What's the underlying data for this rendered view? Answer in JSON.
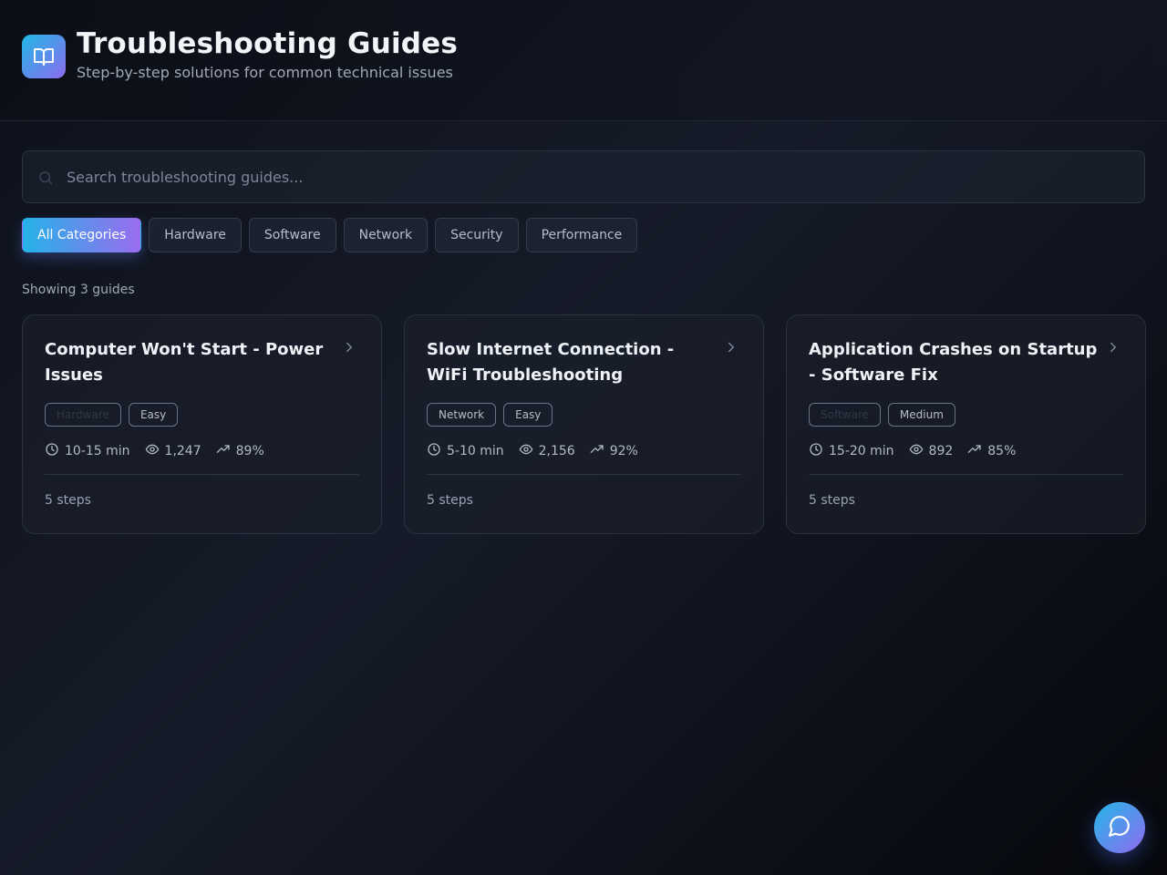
{
  "header": {
    "title": "Troubleshooting Guides",
    "subtitle": "Step-by-step solutions for common technical issues",
    "logo_icon": "book-open-icon"
  },
  "search": {
    "placeholder": "Search troubleshooting guides...",
    "value": ""
  },
  "filters": [
    {
      "label": "All Categories",
      "active": true
    },
    {
      "label": "Hardware",
      "active": false
    },
    {
      "label": "Software",
      "active": false
    },
    {
      "label": "Network",
      "active": false
    },
    {
      "label": "Security",
      "active": false
    },
    {
      "label": "Performance",
      "active": false
    }
  ],
  "results": {
    "count_text": "Showing 3 guides"
  },
  "guides": [
    {
      "title": "Computer Won't Start - Power Issues",
      "category": "Hardware",
      "difficulty": "Easy",
      "time": "10-15 min",
      "views": "1,247",
      "success": "89%",
      "steps": "5 steps"
    },
    {
      "title": "Slow Internet Connection - WiFi Troubleshooting",
      "category": "Network",
      "difficulty": "Easy",
      "time": "5-10 min",
      "views": "2,156",
      "success": "92%",
      "steps": "5 steps"
    },
    {
      "title": "Application Crashes on Startup - Software Fix",
      "category": "Software",
      "difficulty": "Medium",
      "time": "15-20 min",
      "views": "892",
      "success": "85%",
      "steps": "5 steps"
    }
  ],
  "colors": {
    "accent_start": "#25b2e8",
    "accent_end": "#9a6cf0",
    "background": "#111622"
  },
  "chat_button": {
    "icon": "message-circle-icon"
  }
}
